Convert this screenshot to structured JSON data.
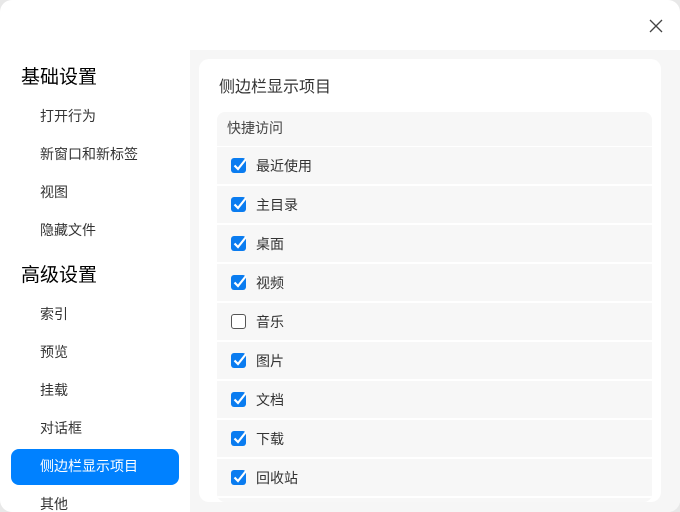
{
  "nav": {
    "sections": [
      {
        "heading": "基础设置",
        "items": [
          "打开行为",
          "新窗口和新标签",
          "视图",
          "隐藏文件"
        ]
      },
      {
        "heading": "高级设置",
        "items": [
          "索引",
          "预览",
          "挂载",
          "对话框",
          "侧边栏显示项目",
          "其他"
        ]
      }
    ],
    "selected": "侧边栏显示项目"
  },
  "panel": {
    "title": "侧边栏显示项目",
    "group_title": "快捷访问",
    "items": [
      {
        "label": "最近使用",
        "checked": true
      },
      {
        "label": "主目录",
        "checked": true
      },
      {
        "label": "桌面",
        "checked": true
      },
      {
        "label": "视频",
        "checked": true
      },
      {
        "label": "音乐",
        "checked": false
      },
      {
        "label": "图片",
        "checked": true
      },
      {
        "label": "文档",
        "checked": true
      },
      {
        "label": "下载",
        "checked": true
      },
      {
        "label": "回收站",
        "checked": true
      }
    ]
  },
  "colors": {
    "accent": "#0081ff"
  }
}
